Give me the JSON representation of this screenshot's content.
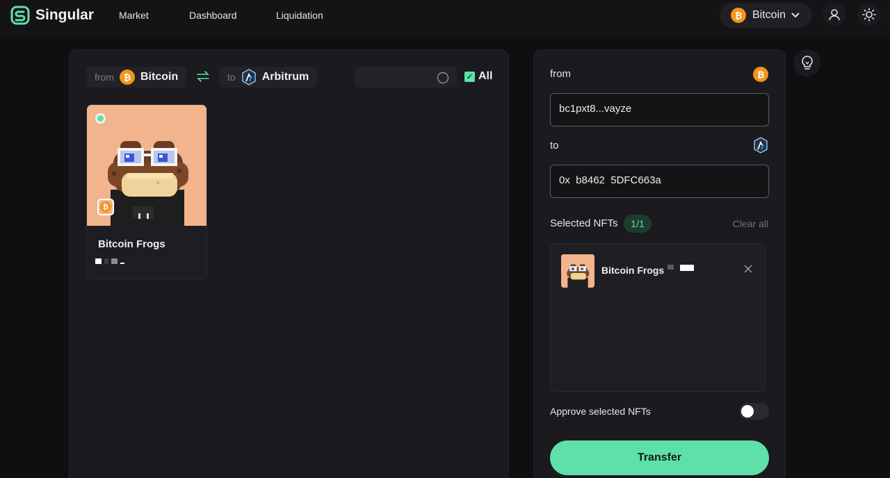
{
  "app": {
    "name": "Singular",
    "nav": [
      "Market",
      "Dashboard",
      "Liquidation"
    ],
    "chain_selector": "Bitcoin"
  },
  "bridge": {
    "from_label": "from",
    "from_chain": "Bitcoin",
    "to_label": "to",
    "to_chain": "Arbitrum",
    "search_placeholder": "",
    "select_all_label": "All"
  },
  "nfts": [
    {
      "name": "Bitcoin Frogs",
      "selected": true,
      "chain_icon": "bitcoin-icon"
    }
  ],
  "transfer": {
    "from_label": "from",
    "from_address": "bc1pxt8...vayze",
    "to_label": "to",
    "to_address": "0x  b8462  5DFC663a",
    "selected_label": "Selected NFTs",
    "selected_count": "1/1",
    "clear_all": "Clear all",
    "selected_items": [
      {
        "name": "Bitcoin Frogs"
      }
    ],
    "approve_label": "Approve selected NFTs",
    "approve_enabled": false,
    "submit_label": "Transfer"
  },
  "colors": {
    "accent": "#5fe0a8",
    "bitcoin": "#f7931a",
    "background": "#0f0f11",
    "panel": "#1a1a1f",
    "nft_bg": "#f2b48d"
  },
  "icons": [
    "singular-logo-icon",
    "bitcoin-icon",
    "chevron-down-icon",
    "user-icon",
    "sun-icon",
    "swap-arrows-icon",
    "arbitrum-icon",
    "search-icon",
    "check-icon",
    "close-icon",
    "lightbulb-icon"
  ]
}
